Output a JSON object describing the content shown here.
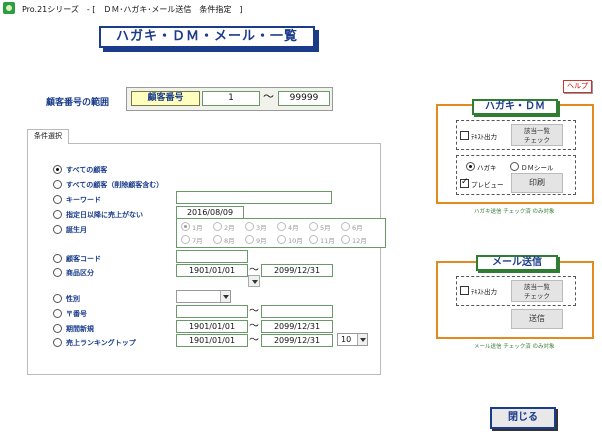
{
  "window": {
    "title": "Pro.21シリーズ　- [　ＤＭ･ハガキ･メール送信　条件指定　]"
  },
  "page_title": "ハガキ・ＤＭ・メール・一覧",
  "help_label": "ヘルプ",
  "customer_range": {
    "label": "顧客番号の範囲",
    "field_label": "顧客番号",
    "from": "1",
    "tilde": "〜",
    "to": "99999"
  },
  "conditions": {
    "tab_label": "条件選択",
    "options": {
      "all": "すべての顧客",
      "all_incl_deleted": "すべての顧客（削除顧客含む）",
      "keyword": "キーワード",
      "no_sales_since": "指定日以降に売上がない",
      "birth_month": "誕生月",
      "customer_code": "顧客コード",
      "product_category": "商品区分",
      "gender": "性別",
      "postal_code": "〒番号",
      "new_in_period": "期間新規",
      "sales_ranking_top": "売上ランキングトップ"
    },
    "selected": "all",
    "keyword_value": "",
    "no_sales_since_value": "2016/08/09",
    "months": [
      "1月",
      "2月",
      "3月",
      "4月",
      "5月",
      "6月",
      "7月",
      "8月",
      "9月",
      "10月",
      "11月",
      "12月"
    ],
    "selected_month": "1月",
    "customer_code_value": "",
    "product_from": "1901/01/01",
    "product_to": "2099/12/31",
    "gender_value": "",
    "postal_from": "",
    "postal_to": "",
    "new_from": "1901/01/01",
    "new_to": "2099/12/31",
    "rank_from": "1901/01/01",
    "rank_to": "2099/12/31",
    "rank_count": "10",
    "tilde": "〜"
  },
  "hagaki_panel": {
    "title": "ハガキ・ＤＭ",
    "text_output_label": "ﾃｷｽﾄ出力",
    "text_output_checked": false,
    "check_list_button": [
      "該当一覧",
      "チェック"
    ],
    "radio_hagaki": "ハガキ",
    "radio_dm_seal": "ＤＭシール",
    "selected_output": "ハガキ",
    "preview_label": "プレビュー",
    "preview_checked": true,
    "print_button": "印刷",
    "note": "ハガキ送信 チェック済 のみ対象"
  },
  "mail_panel": {
    "title": "メール送信",
    "text_output_label": "ﾃｷｽﾄ出力",
    "text_output_checked": false,
    "check_list_button": [
      "該当一覧",
      "チェック"
    ],
    "send_button": "送信",
    "note": "メール送信 チェック済 のみ対象"
  },
  "close_button": "閉じる",
  "colors": {
    "accent_blue": "#1a3c8b",
    "panel_orange": "#e38a1f",
    "panel_green": "#2e7d32",
    "field_yellow": "#ffffc0"
  }
}
